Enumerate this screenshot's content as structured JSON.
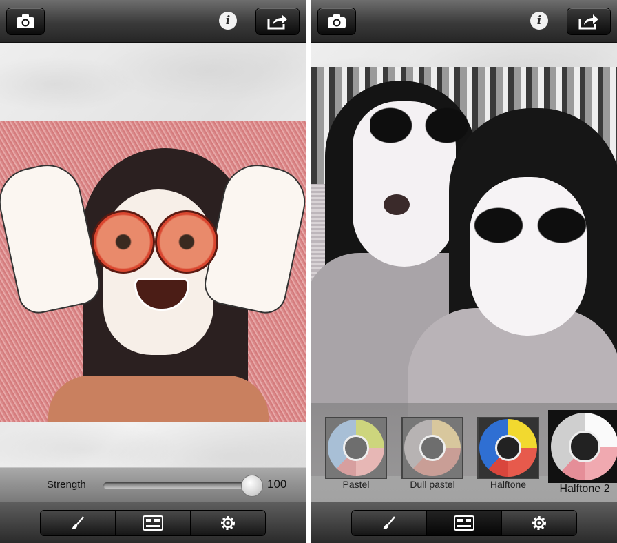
{
  "screens": [
    {
      "icons": {
        "camera": "camera-icon",
        "info": "info-icon",
        "share": "share-icon"
      },
      "info_glyph": "i",
      "strength": {
        "label": "Strength",
        "value": "100",
        "fraction": 1.0
      },
      "toolbar": [
        {
          "icon": "brush-icon",
          "selected": false
        },
        {
          "icon": "filter-sliders-icon",
          "selected": false
        },
        {
          "icon": "gear-icon",
          "selected": false
        }
      ]
    },
    {
      "icons": {
        "camera": "camera-icon",
        "info": "info-icon",
        "share": "share-icon"
      },
      "info_glyph": "i",
      "filters": [
        {
          "label": "Pastel",
          "selected": false
        },
        {
          "label": "Dull pastel",
          "selected": false
        },
        {
          "label": "Halftone",
          "selected": false
        },
        {
          "label": "Halftone 2",
          "selected": true
        }
      ],
      "toolbar": [
        {
          "icon": "brush-icon",
          "selected": false
        },
        {
          "icon": "filter-sliders-icon",
          "selected": true
        },
        {
          "icon": "gear-icon",
          "selected": false
        }
      ]
    }
  ]
}
